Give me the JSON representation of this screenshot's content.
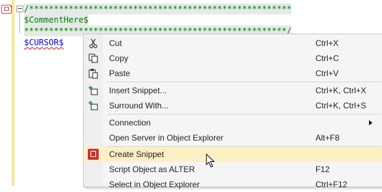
{
  "editor": {
    "lines": [
      {
        "text": "/*****************************************************"
      },
      {
        "text": "$CommentHere$"
      },
      {
        "text": "*****************************************************/"
      },
      {
        "text": "$CURSOR$"
      }
    ]
  },
  "context_menu": {
    "items": [
      {
        "label": "Cut",
        "shortcut": "Ctrl+X",
        "icon": "scissors-icon"
      },
      {
        "label": "Copy",
        "shortcut": "Ctrl+C",
        "icon": "copy-icon"
      },
      {
        "label": "Paste",
        "shortcut": "Ctrl+V",
        "icon": "paste-icon"
      },
      {
        "label": "Insert Snippet...",
        "shortcut": "Ctrl+K, Ctrl+X",
        "icon": "insert-snippet-icon"
      },
      {
        "label": "Surround With...",
        "shortcut": "Ctrl+K, Ctrl+S",
        "icon": "surround-with-icon"
      },
      {
        "label": "Connection",
        "shortcut": "",
        "icon": "submenu-arrow-icon"
      },
      {
        "label": "Open Server in Object Explorer",
        "shortcut": "Alt+F8",
        "icon": ""
      },
      {
        "label": "Create Snippet",
        "shortcut": "",
        "icon": "create-snippet-icon"
      },
      {
        "label": "Script Object as ALTER",
        "shortcut": "F12",
        "icon": ""
      },
      {
        "label": "Select in Object Explorer",
        "shortcut": "Ctrl+F12",
        "icon": ""
      }
    ]
  },
  "colors": {
    "highlight": "#fbf0c4",
    "comment": "#008000",
    "placeholder": "#0000ff",
    "snippet_icon": "#c8342f"
  }
}
